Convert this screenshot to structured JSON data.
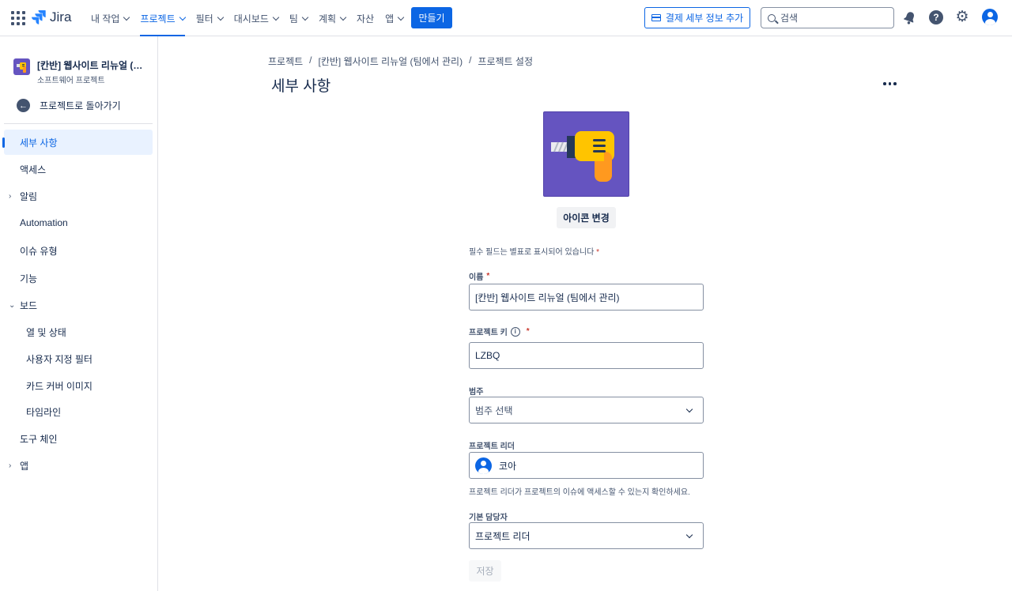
{
  "topbar": {
    "logo_text": "Jira",
    "nav": [
      {
        "label": "내 작업",
        "dropdown": true
      },
      {
        "label": "프로젝트",
        "dropdown": true,
        "active": true
      },
      {
        "label": "필터",
        "dropdown": true
      },
      {
        "label": "대시보드",
        "dropdown": true
      },
      {
        "label": "팀",
        "dropdown": true
      },
      {
        "label": "계획",
        "dropdown": true
      },
      {
        "label": "자산",
        "dropdown": false
      },
      {
        "label": "앱",
        "dropdown": true
      }
    ],
    "create_label": "만들기",
    "billing_label": "결제 세부 정보 추가",
    "search_placeholder": "검색",
    "icons": [
      "apps-grid-icon",
      "notification-icon",
      "help-icon",
      "settings-icon",
      "profile-icon"
    ]
  },
  "sidebar": {
    "project_name": "[칸반] 웹사이트 리뉴얼 (팀에서 관리)",
    "project_type": "소프트웨어 프로젝트",
    "back_label": "프로젝트로 돌아가기",
    "items": [
      {
        "label": "세부 사항",
        "active": true
      },
      {
        "label": "액세스"
      },
      {
        "label": "알림",
        "expandable": true
      },
      {
        "label": "Automation"
      },
      {
        "label": "이슈 유형"
      },
      {
        "label": "기능"
      },
      {
        "label": "보드",
        "expanded": true
      },
      {
        "label": "열 및 상태",
        "indent": true
      },
      {
        "label": "사용자 지정 필터",
        "indent": true
      },
      {
        "label": "카드 커버 이미지",
        "indent": true
      },
      {
        "label": "타임라인",
        "indent": true
      },
      {
        "label": "도구 체인"
      },
      {
        "label": "앱",
        "expandable": true
      }
    ]
  },
  "main": {
    "breadcrumb": [
      "프로젝트",
      "[칸반] 웹사이트 리뉴얼 (팀에서 관리)",
      "프로젝트 설정"
    ],
    "breadcrumb_sep": "/",
    "title": "세부 사항",
    "change_icon_label": "아이콘 변경",
    "required_note": "필수 필드는 별표로 표시되어 있습니다",
    "fields": {
      "name_label": "이름",
      "name_value": "[칸반] 웹사이트 리뉴얼 (팀에서 관리)",
      "key_label": "프로젝트 키",
      "key_value": "LZBQ",
      "category_label": "범주",
      "category_placeholder": "범주 선택",
      "lead_label": "프로젝트 리더",
      "lead_value": "코아",
      "lead_helper": "프로젝트 리더가 프로젝트의 이슈에 액세스할 수 있는지 확인하세요.",
      "assignee_label": "기본 담당자",
      "assignee_value": "프로젝트 리더"
    },
    "save_label": "저장",
    "required_star": "*"
  },
  "colors": {
    "brand": "#0C66E4",
    "project_icon_bg": "#6554C0",
    "drill_yellow": "#FFC400",
    "required": "#C9372C"
  }
}
